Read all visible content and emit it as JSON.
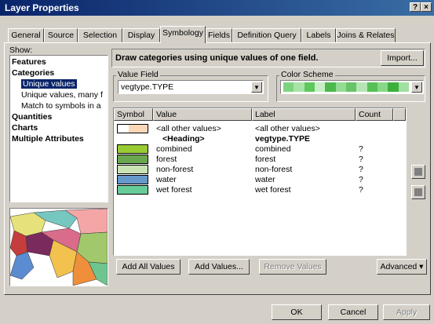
{
  "window": {
    "title": "Layer Properties",
    "help_btn": "?",
    "close_btn": "×"
  },
  "tabs": [
    "General",
    "Source",
    "Selection",
    "Display",
    "Symbology",
    "Fields",
    "Definition Query",
    "Labels",
    "Joins & Relates"
  ],
  "active_tab": "Symbology",
  "show": {
    "label": "Show:",
    "items": [
      {
        "label": "Features",
        "bold": true
      },
      {
        "label": "Categories",
        "bold": true
      },
      {
        "label": "Unique values",
        "selected": true
      },
      {
        "label": "Unique values, many f"
      },
      {
        "label": "Match to symbols in a"
      },
      {
        "label": "Quantities",
        "bold": true
      },
      {
        "label": "Charts",
        "bold": true
      },
      {
        "label": "Multiple Attributes",
        "bold": true
      }
    ]
  },
  "description": "Draw categories using unique values of one field.",
  "import_btn": "Import...",
  "value_field": {
    "label": "Value Field",
    "value": "vegtype.TYPE"
  },
  "color_scheme": {
    "label": "Color Scheme",
    "colors": [
      "#7ed47e",
      "#a8e4a8",
      "#5ec85e",
      "#c8eec8",
      "#4cb84c",
      "#94dc94",
      "#68c468",
      "#b4e6b4",
      "#56c056",
      "#88d888",
      "#3cb03c",
      "#a0e0a0"
    ]
  },
  "table": {
    "headers": [
      "Symbol",
      "Value",
      "Label",
      "Count"
    ],
    "rows": [
      {
        "color": "#fbd7b8",
        "value": "<all other values>",
        "label": "<all other values>",
        "count": "",
        "outline_only": true
      },
      {
        "color": "",
        "value": "<Heading>",
        "label": "vegtype.TYPE",
        "count": "",
        "heading": true
      },
      {
        "color": "#99cc33",
        "value": "combined",
        "label": "combined",
        "count": "?"
      },
      {
        "color": "#6aa84f",
        "value": "forest",
        "label": "forest",
        "count": "?"
      },
      {
        "color": "#c9e3b5",
        "value": "non-forest",
        "label": "non-forest",
        "count": "?"
      },
      {
        "color": "#6699cc",
        "value": "water",
        "label": "water",
        "count": "?"
      },
      {
        "color": "#66cc99",
        "value": "wet forest",
        "label": "wet forest",
        "count": "?"
      }
    ]
  },
  "buttons": {
    "add_all": "Add All Values",
    "add_values": "Add Values...",
    "remove_values": "Remove Values",
    "advanced": "Advanced ▾",
    "ok": "OK",
    "cancel": "Cancel",
    "apply": "Apply"
  }
}
